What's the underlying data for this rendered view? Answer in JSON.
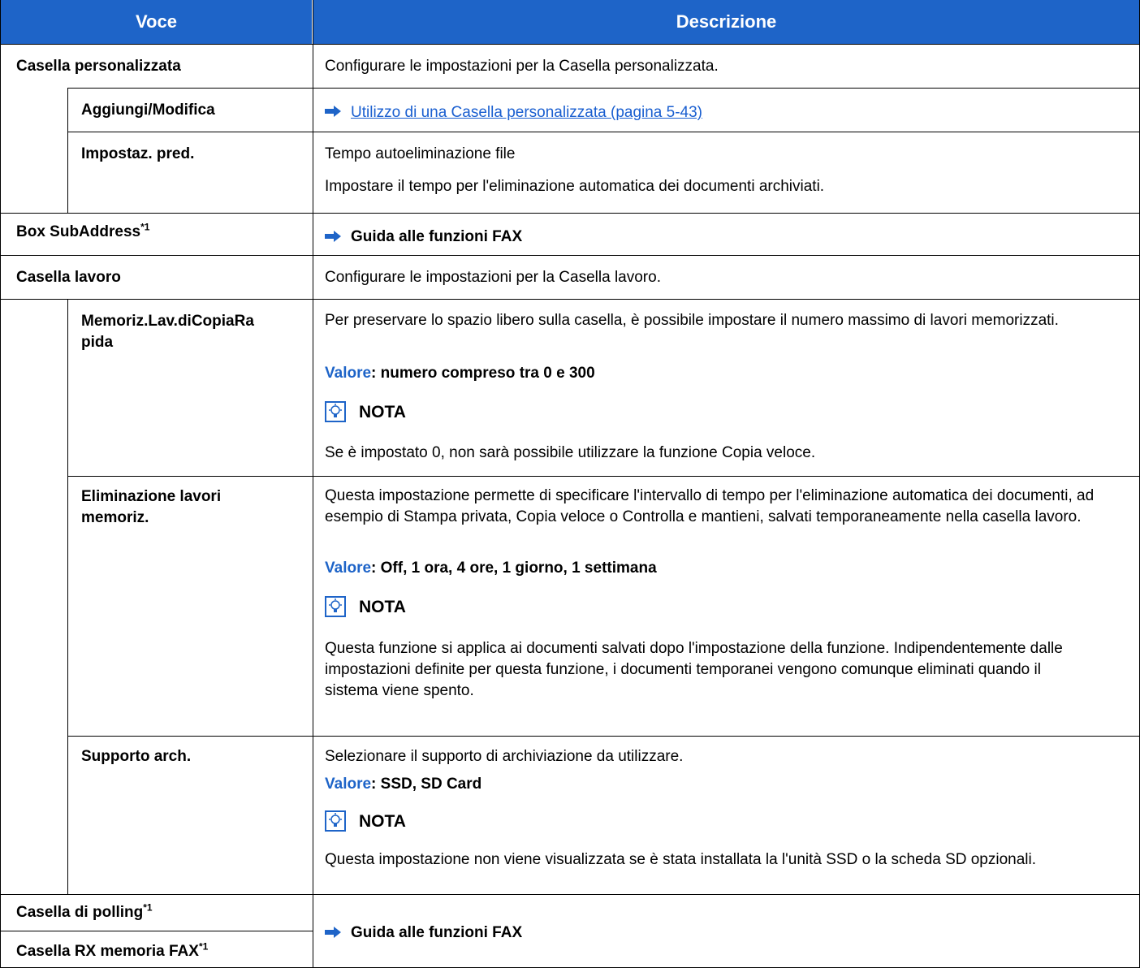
{
  "header": {
    "col1": "Voce",
    "col2": "Descrizione"
  },
  "rows": {
    "casella_personalizzata": {
      "label": "Casella personalizzata",
      "desc": "Configurare le impostazioni per la Casella personalizzata."
    },
    "aggiungi_modifica": {
      "label": "Aggiungi/Modifica",
      "link": "Utilizzo di una Casella personalizzata (pagina 5-43)"
    },
    "impostaz_pred": {
      "label": "Impostaz. pred.",
      "line1": "Tempo autoeliminazione file",
      "line2": "Impostare il tempo per l'eliminazione automatica dei documenti archiviati."
    },
    "box_subaddress": {
      "label": "Box SubAddress",
      "sup": "*1",
      "ref": "Guida alle funzioni FAX"
    },
    "casella_lavoro": {
      "label": "Casella lavoro",
      "desc": "Configurare le impostazioni per la Casella lavoro."
    },
    "memoriz": {
      "label_line1": "Memoriz.Lav.diCopiaRa",
      "label_line2": "pida",
      "desc": "Per preservare lo spazio libero sulla casella, è possibile impostare il numero massimo di lavori memorizzati.",
      "value_key": "Valore",
      "value": ": numero compreso tra 0 e 300",
      "note_title": "NOTA",
      "note": "Se è impostato 0, non sarà possibile utilizzare la funzione Copia veloce."
    },
    "eliminazione": {
      "label_line1": "Eliminazione lavori",
      "label_line2": "memoriz.",
      "desc": "Questa impostazione permette di specificare l'intervallo di tempo per l'eliminazione automatica dei documenti, ad esempio di Stampa privata, Copia veloce o Controlla e mantieni, salvati temporaneamente nella casella lavoro.",
      "value_key": "Valore",
      "value": ": Off, 1 ora, 4 ore, 1 giorno, 1 settimana",
      "note_title": "NOTA",
      "note": "Questa funzione si applica ai documenti salvati dopo l'impostazione della funzione. Indipendentemente dalle impostazioni definite per questa funzione, i documenti temporanei vengono comunque eliminati quando il sistema viene spento."
    },
    "supporto": {
      "label": "Supporto arch.",
      "desc": "Selezionare il supporto di archiviazione da utilizzare.",
      "value_key": "Valore",
      "value": ": SSD, SD Card",
      "note_title": "NOTA",
      "note": "Questa impostazione non viene visualizzata se è stata installata la l'unità SSD o la scheda SD opzionali."
    },
    "casella_polling": {
      "label": "Casella di polling",
      "sup": "*1"
    },
    "casella_rx": {
      "label": "Casella RX memoria FAX",
      "sup": "*1"
    },
    "fax_ref": "Guida alle funzioni FAX"
  },
  "colors": {
    "header_bg": "#1e64c8",
    "link": "#1a5fd0",
    "value": "#1e64c8"
  }
}
